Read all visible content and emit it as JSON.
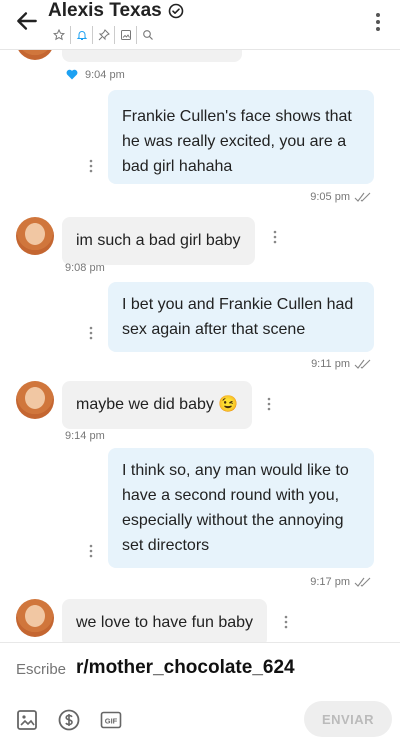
{
  "header": {
    "title": "Alexis Texas",
    "icons": [
      "back-arrow-icon",
      "verified-icon",
      "star-icon",
      "bell-icon",
      "pin-icon",
      "image-icon",
      "search-icon",
      "kebab-menu-icon"
    ]
  },
  "messages": [
    {
      "dir": "in",
      "text": "",
      "time": "9:04 pm",
      "reaction": "heart-icon"
    },
    {
      "dir": "out",
      "text": "Frankie Cullen's face shows that he was really excited, you are a bad girl hahaha",
      "time": "9:05 pm"
    },
    {
      "dir": "in",
      "text": "im such a bad girl baby",
      "time": "9:08 pm"
    },
    {
      "dir": "out",
      "text": "I bet you and Frankie Cullen had sex again after that scene",
      "time": "9:11 pm"
    },
    {
      "dir": "in",
      "text": "maybe we did baby 😉",
      "time": "9:14 pm"
    },
    {
      "dir": "out",
      "text": "I think so, any man would like to have a second round with you, especially without the annoying set directors",
      "time": "9:17 pm"
    },
    {
      "dir": "in",
      "text": "we love to have fun baby",
      "time": ""
    }
  ],
  "composer": {
    "placeholder": "Escribe",
    "watermark": "r/mother_chocolate_624",
    "send_label": "ENVIAR",
    "tools": [
      "image-icon",
      "dollar-icon",
      "gif-icon"
    ]
  },
  "colors": {
    "outgoing_bubble": "#e7f3fb",
    "incoming_bubble": "#f1f1f1",
    "heart": "#1da1f2"
  }
}
